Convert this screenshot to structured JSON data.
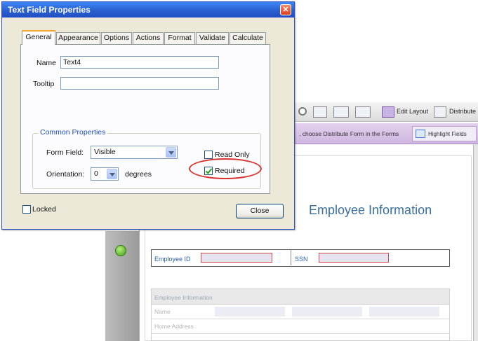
{
  "dialog": {
    "title": "Text Field Properties",
    "close_glyph": "✕",
    "tabs": [
      {
        "label": "General",
        "active": true
      },
      {
        "label": "Appearance"
      },
      {
        "label": "Options"
      },
      {
        "label": "Actions"
      },
      {
        "label": "Format"
      },
      {
        "label": "Validate"
      },
      {
        "label": "Calculate"
      }
    ],
    "name_label": "Name",
    "name_value": "Text4",
    "tooltip_label": "Tooltip",
    "tooltip_value": "",
    "common_properties": {
      "legend": "Common Properties",
      "form_field_label": "Form Field:",
      "form_field_value": "Visible",
      "orientation_label": "Orientation:",
      "orientation_value": "0",
      "degrees_label": "degrees",
      "read_only_label": "Read Only",
      "read_only_checked": false,
      "required_label": "Required",
      "required_checked": true
    },
    "locked_label": "Locked",
    "locked_checked": false,
    "close_button": "Close"
  },
  "background_app": {
    "toolbar": {
      "edit_layout_label": "Edit Layout",
      "distribute_label": "Distribute"
    },
    "message_bar": {
      "text": ", choose Distribute Form in the Forms",
      "highlight_button": "Highlight Fields"
    },
    "form": {
      "title": "Employee Information",
      "employee_id_label": "Employee ID",
      "ssn_label": "SSN",
      "section_header": "Employee Information",
      "rows": [
        "Name",
        "Home Address"
      ]
    }
  },
  "colors": {
    "accent_title": "#2a5fd0",
    "annotation_circle": "#d8332f",
    "form_title": "#3a6f9a"
  }
}
